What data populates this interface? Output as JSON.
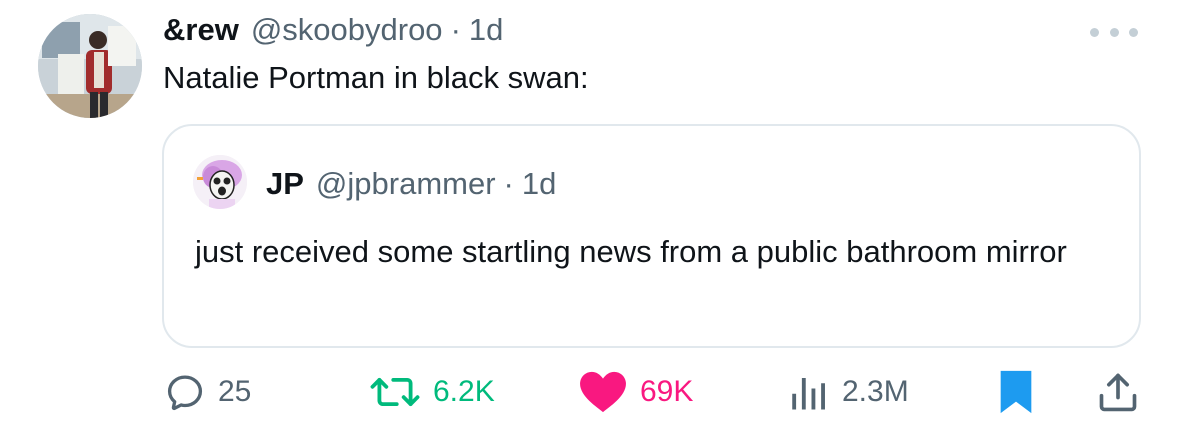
{
  "tweet": {
    "display_name": "&rew",
    "handle": "@skoobydroo",
    "separator": "·",
    "time": "1d",
    "text": "Natalie Portman in black swan:"
  },
  "quoted_tweet": {
    "display_name": "JP",
    "handle": "@jpbrammer",
    "separator": "·",
    "time": "1d",
    "text": "just received some startling news from a public bathroom mirror"
  },
  "actions": {
    "replies": "25",
    "retweets": "6.2K",
    "likes": "69K",
    "views": "2.3M"
  },
  "colors": {
    "retweet": "#00ba7c",
    "like": "#f91880",
    "bookmark": "#1d9bf0",
    "secondary_text": "#536471",
    "icon": "#536471"
  },
  "icons": [
    "more-icon",
    "reply-icon",
    "retweet-icon",
    "like-icon",
    "views-icon",
    "bookmark-icon",
    "share-icon"
  ]
}
